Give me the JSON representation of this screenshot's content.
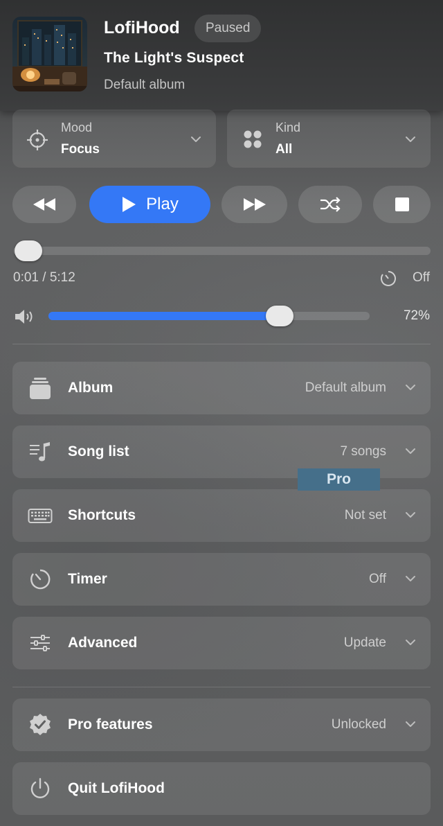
{
  "header": {
    "app_title": "LofiHood",
    "status": "Paused",
    "song_title": "The Light's Suspect",
    "album_name": "Default album"
  },
  "selectors": {
    "mood": {
      "label": "Mood",
      "value": "Focus",
      "icon": "crosshair-icon"
    },
    "kind": {
      "label": "Kind",
      "value": "All",
      "icon": "grid-dots-icon"
    }
  },
  "controls": {
    "play_label": "Play",
    "buttons": [
      "rewind-icon",
      "play-icon",
      "fast-forward-icon",
      "shuffle-icon",
      "stop-icon"
    ]
  },
  "progress": {
    "elapsed_total": "0:01 / 5:12",
    "fraction": 0.003,
    "timer_label": "Off"
  },
  "volume": {
    "percent_label": "72%",
    "level": 0.72
  },
  "menu": {
    "album": {
      "label": "Album",
      "value": "Default album"
    },
    "song_list": {
      "label": "Song list",
      "value": "7 songs"
    },
    "pro_tag": "Pro",
    "shortcuts": {
      "label": "Shortcuts",
      "value": "Not set"
    },
    "timer": {
      "label": "Timer",
      "value": "Off"
    },
    "advanced": {
      "label": "Advanced",
      "value": "Update"
    },
    "pro_features": {
      "label": "Pro features",
      "value": "Unlocked"
    },
    "quit": {
      "label": "Quit LofiHood"
    }
  },
  "colors": {
    "accent": "#3478f6",
    "panel": "#5f6061",
    "pro_tag": "#456f8a"
  }
}
